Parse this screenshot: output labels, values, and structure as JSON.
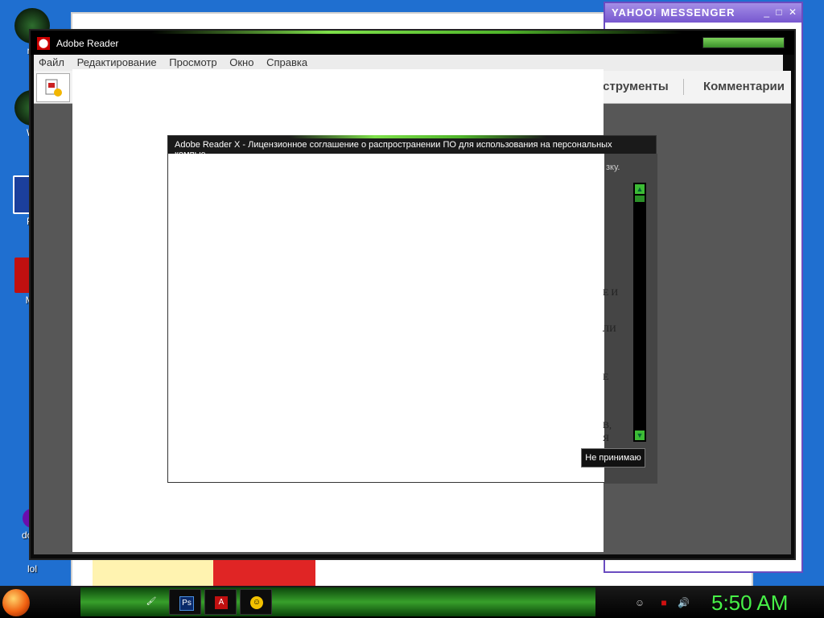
{
  "desktop": {
    "icons": [
      {
        "label": "mi"
      },
      {
        "label": "Wi"
      },
      {
        "label": "Pc"
      },
      {
        "label": "Mo"
      },
      {
        "label": "does"
      },
      {
        "label": "lol"
      }
    ]
  },
  "yahoo": {
    "title": "YAHOO! MESSENGER",
    "controls": [
      "_",
      "□",
      "✕"
    ]
  },
  "adobe_reader": {
    "title": "Adobe Reader",
    "menu": [
      "Файл",
      "Редактирование",
      "Просмотр",
      "Окно",
      "Справка"
    ],
    "toolbar_right": [
      "нструменты",
      "Комментарии"
    ]
  },
  "license_dialog": {
    "title": "Adobe Reader X - Лицензионное соглашение о распространении ПО для использования на персональных компью...",
    "note": "зку.",
    "text_fragments": [
      "Е И",
      "ЛИ",
      "Е",
      "В,",
      "Я"
    ],
    "decline_button": "Не принимаю"
  },
  "taskbar": {
    "buttons": [
      {
        "icon": "paint-icon",
        "label": "🖌"
      },
      {
        "icon": "photoshop-icon",
        "label": "Ps"
      },
      {
        "icon": "acrobat-icon",
        "label": "A"
      },
      {
        "icon": "yahoo-icon",
        "label": "☺"
      }
    ],
    "tray": [
      "",
      "☺",
      "■",
      "🔊"
    ],
    "clock": "5:50 AM"
  },
  "colors": {
    "accent_green": "#47f047",
    "desktop_blue": "#1f6fd0",
    "reader_gray": "#575757"
  }
}
